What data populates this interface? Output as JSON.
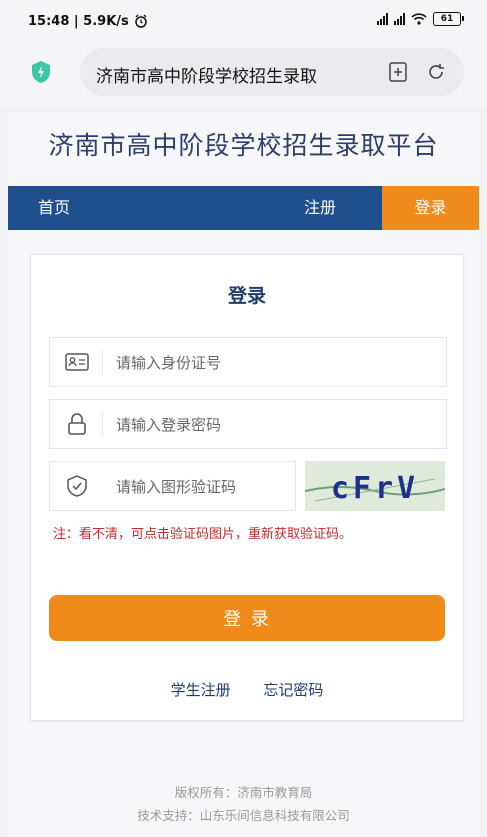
{
  "status_bar": {
    "time": "15:48 | 5.9K/s",
    "battery": "61"
  },
  "browser": {
    "url_text": "济南市高中阶段学校招生录取"
  },
  "site": {
    "title": "济南市高中阶段学校招生录取平台"
  },
  "nav": {
    "home": "首页",
    "register": "注册",
    "login": "登录"
  },
  "login_form": {
    "title": "登录",
    "id_placeholder": "请输入身份证号",
    "password_placeholder": "请输入登录密码",
    "captcha_placeholder": "请输入图形验证码",
    "captcha_text": "cFrV",
    "note": "注：看不清，可点击验证码图片，重新获取验证码。",
    "submit": "登 录",
    "student_register": "学生注册",
    "forgot_password": "忘记密码"
  },
  "footer": {
    "copyright": "版权所有：济南市教育局",
    "support": "技术支持：山东乐间信息科技有限公司"
  },
  "colors": {
    "nav_bg": "#1f4e8c",
    "accent": "#f08a18",
    "title": "#2c3e6b",
    "note": "#c8282a"
  },
  "icons": [
    "alarm-icon",
    "signal-icon",
    "wifi-icon",
    "battery-icon",
    "shield-icon",
    "bookmark-icon",
    "refresh-icon",
    "id-card-icon",
    "lock-icon",
    "shield-check-icon"
  ]
}
